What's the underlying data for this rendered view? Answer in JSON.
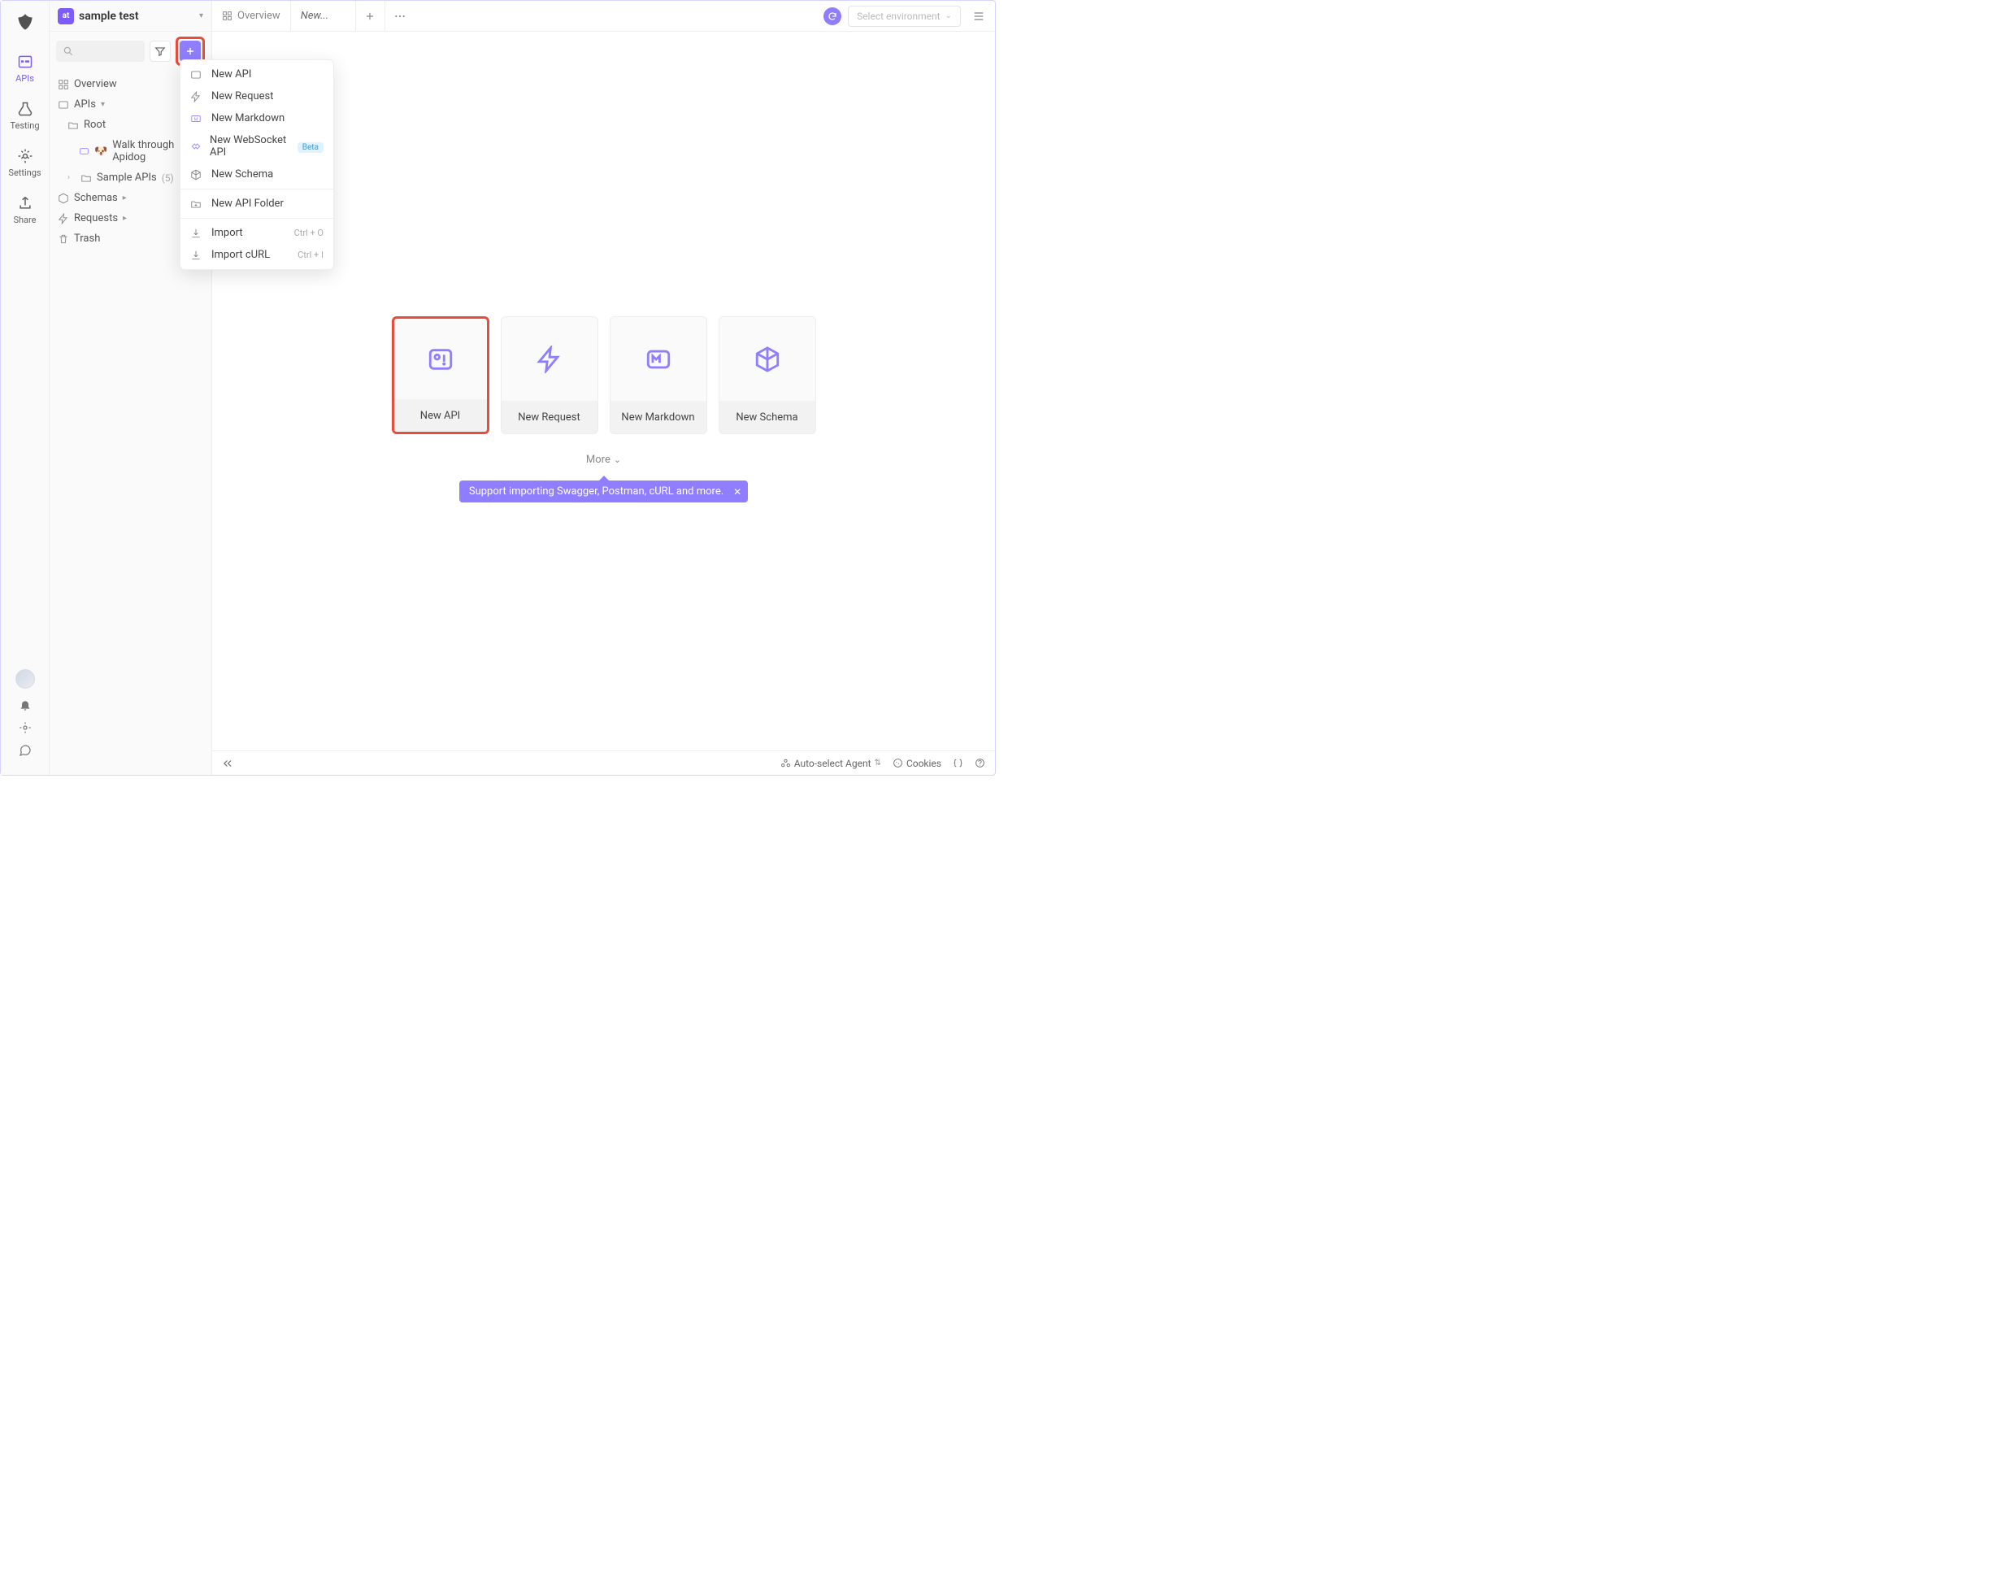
{
  "rail": {
    "items": [
      {
        "key": "apis",
        "label": "APIs",
        "active": true
      },
      {
        "key": "testing",
        "label": "Testing",
        "active": false
      },
      {
        "key": "settings",
        "label": "Settings",
        "active": false
      },
      {
        "key": "share",
        "label": "Share",
        "active": false
      }
    ]
  },
  "project": {
    "name": "sample test",
    "icon_initials": "at"
  },
  "sidebar": {
    "overview": "Overview",
    "apis_section": "APIs",
    "root": "Root",
    "walk": "Walk through Apidog",
    "sample_apis": "Sample APIs",
    "sample_apis_count": "(5)",
    "schemas": "Schemas",
    "requests": "Requests",
    "trash": "Trash"
  },
  "dropdown": {
    "new_api": "New API",
    "new_request": "New Request",
    "new_markdown": "New Markdown",
    "new_websocket": "New WebSocket API",
    "websocket_badge": "Beta",
    "new_schema": "New Schema",
    "new_folder": "New API Folder",
    "import": "Import",
    "import_shortcut": "Ctrl + O",
    "import_curl": "Import cURL",
    "import_curl_shortcut": "Ctrl + I"
  },
  "tabs": {
    "overview": "Overview",
    "new": "New..."
  },
  "env": {
    "placeholder": "Select environment"
  },
  "cards": {
    "new_api": "New API",
    "new_request": "New Request",
    "new_markdown": "New Markdown",
    "new_schema": "New Schema"
  },
  "more": "More",
  "tooltip": "Support importing Swagger, Postman, cURL and more.",
  "footer": {
    "agent": "Auto-select Agent",
    "cookies": "Cookies"
  }
}
